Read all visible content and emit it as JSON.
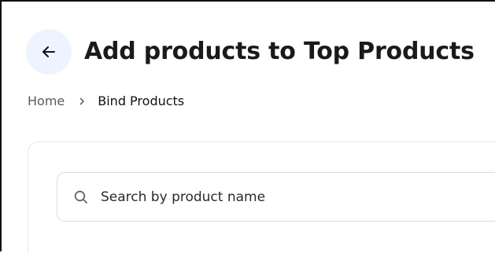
{
  "header": {
    "title": "Add products to Top Products",
    "back_icon": "arrow-left-icon"
  },
  "breadcrumb": {
    "items": [
      {
        "label": "Home"
      },
      {
        "label": "Bind Products"
      }
    ],
    "separator_icon": "chevron-right-icon"
  },
  "search": {
    "placeholder": "Search by product name",
    "value": "",
    "icon": "search-icon"
  },
  "colors": {
    "back_button_bg": "#eef4ff",
    "title_text": "#1a1a1a",
    "border": "#dddddd"
  }
}
